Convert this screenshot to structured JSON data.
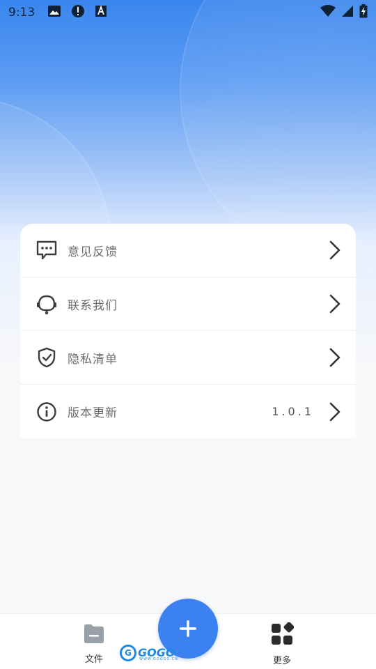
{
  "status_bar": {
    "time": "9:13",
    "icons_left": [
      "image-icon",
      "alert-circle-icon",
      "text-a-icon"
    ],
    "icons_right": [
      "wifi-icon",
      "signal-icon",
      "battery-charging-icon"
    ]
  },
  "menu": {
    "items": [
      {
        "label": "意见反馈",
        "icon": "feedback-chat-icon",
        "value": ""
      },
      {
        "label": "联系我们",
        "icon": "headset-icon",
        "value": ""
      },
      {
        "label": "隐私清单",
        "icon": "shield-check-icon",
        "value": ""
      },
      {
        "label": "版本更新",
        "icon": "info-icon",
        "value": "1.0.1"
      }
    ]
  },
  "bottom_nav": {
    "files_label": "文件",
    "more_label": "更多"
  },
  "watermark": {
    "brand": "GOGO",
    "sub": "WWW.GOGGO.CN"
  },
  "colors": {
    "accent": "#3b82f0",
    "hero_top": "#3a86ee",
    "background": "#f7f8fa"
  }
}
